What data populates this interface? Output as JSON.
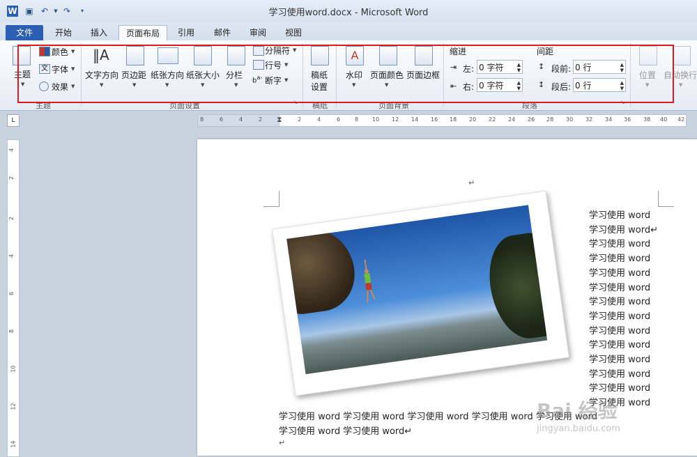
{
  "titlebar": {
    "title": "学习使用word.docx - Microsoft Word"
  },
  "tabs": [
    "文件",
    "开始",
    "插入",
    "页面布局",
    "引用",
    "邮件",
    "审阅",
    "视图"
  ],
  "ribbon": {
    "theme": {
      "main": "主题",
      "colors": "颜色",
      "fonts": "字体",
      "effects": "效果",
      "group": "主题"
    },
    "page_setup": {
      "text_dir": "文字方向",
      "margins": "页边距",
      "orientation": "纸张方向",
      "size": "纸张大小",
      "columns": "分栏",
      "breaks": "分隔符",
      "line_numbers": "行号",
      "hyphenation": "断字",
      "group": "页面设置"
    },
    "draft": {
      "label1": "稿纸",
      "label2": "设置",
      "group": "稿纸"
    },
    "background": {
      "watermark": "水印",
      "page_color": "页面颜色",
      "page_border": "页面边框",
      "group": "页面背景"
    },
    "paragraph": {
      "indent_title": "缩进",
      "left_label": "左:",
      "left_value": "0 字符",
      "right_label": "右:",
      "right_value": "0 字符",
      "spacing_title": "间距",
      "before_label": "段前:",
      "before_value": "0 行",
      "after_label": "段后:",
      "after_value": "0 行",
      "group": "段落"
    },
    "arrange": {
      "position": "位置",
      "wrap": "自动换行"
    }
  },
  "ruler": {
    "h_ticks": [
      "8",
      "6",
      "4",
      "2",
      "2",
      "4",
      "6",
      "8",
      "10",
      "12",
      "14",
      "16",
      "18",
      "20",
      "22",
      "24",
      "26",
      "28",
      "30",
      "32",
      "34",
      "36",
      "38",
      "40",
      "42"
    ],
    "v_ticks": [
      "4",
      "2",
      "2",
      "4",
      "6",
      "8",
      "10",
      "12",
      "14"
    ]
  },
  "document": {
    "right_lines": [
      "学习使用  word",
      "学习使用 word↵",
      "学习使用  word",
      "学习使用  word",
      "学习使用  word",
      "学习使用  word",
      "学习使用  word",
      "学习使用  word",
      "学习使用  word",
      "学习使用  word",
      "学习使用  word",
      "学习使用  word",
      "学习使用  word",
      "学习使用  word"
    ],
    "body_line1": "学习使用 word 学习使用 word 学习使用 word 学习使用 word 学习使用 word",
    "body_line2": "学习使用 word 学习使用 word↵",
    "para_mark": "↵",
    "top_mark": "↵"
  },
  "watermark": {
    "text": "Bai 经验",
    "url": "jingyan.baidu.com"
  }
}
